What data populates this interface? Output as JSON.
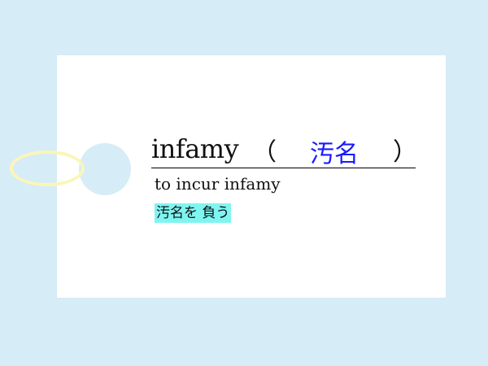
{
  "card": {
    "word": "infamy",
    "paren_open": "（",
    "answer": "汚名",
    "paren_close": "）",
    "example_phrase": "to incur infamy",
    "example_translation": "汚名を 負う"
  },
  "colors": {
    "background": "#d6ecf7",
    "card": "#ffffff",
    "answer_text": "#1a1aff",
    "highlight": "#7ff5f2",
    "ring": "#fbf6b8"
  }
}
